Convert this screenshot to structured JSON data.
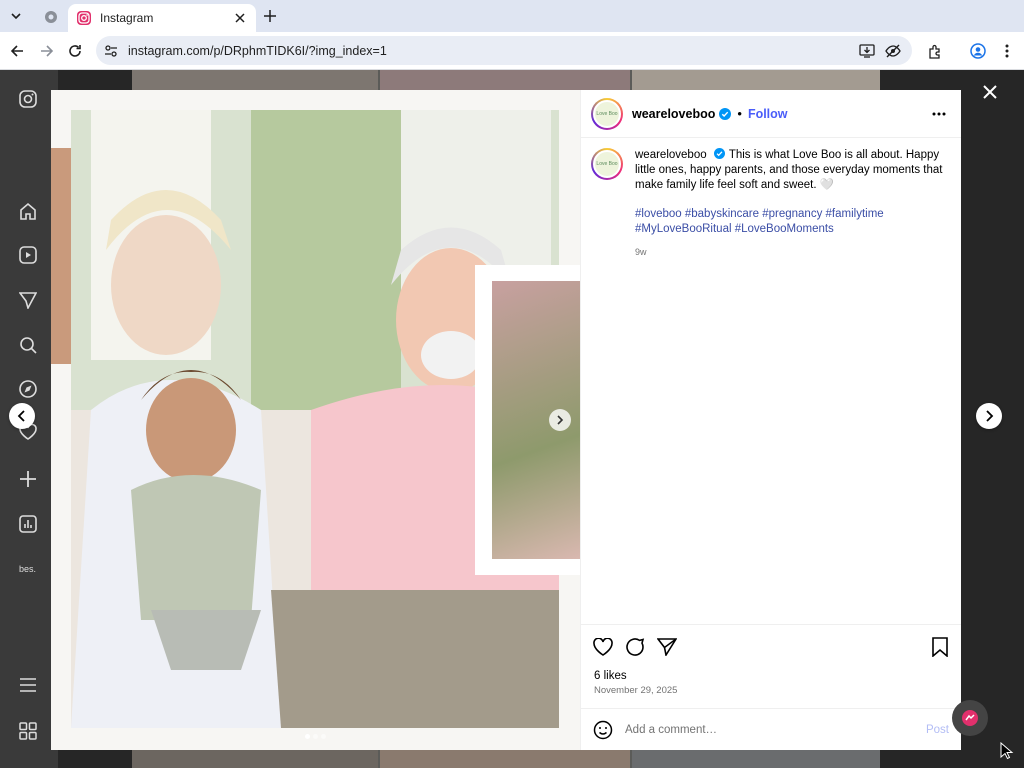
{
  "browser": {
    "tab_title": "Instagram",
    "url": "instagram.com/p/DRphmTIDK6I/?img_index=1"
  },
  "icons": {
    "tab_dropdown": "chevron-down-icon",
    "inactive_tab": "globe-icon",
    "tab_favicon": "instagram-icon",
    "tab_close": "close-icon",
    "new_tab": "plus-icon",
    "back": "arrow-left-icon",
    "forward": "arrow-right-icon",
    "reload": "reload-icon",
    "site_info": "tune-icon",
    "install": "install-app-icon",
    "eye_off": "eye-off-icon",
    "extensions": "puzzle-icon",
    "profile": "profile-icon",
    "menu": "kebab-icon"
  },
  "sidebar": {
    "more_text": "bes."
  },
  "post": {
    "username": "wearelovebo o",
    "handle": "weareloveboo",
    "follow_label": "Follow",
    "separator": "•",
    "avatar_text": "Love Boo",
    "caption_text": "This is what Love Boo is all about. Happy little ones, happy parents, and those everyday moments that make family life feel soft and sweet. 🤍",
    "hashtags": "#loveboo #babyskincare #pregnancy #familytime #MyLoveBooRitual #LoveBooMoments",
    "time_ago": "9w",
    "likes": "6 likes",
    "date": "November 29, 2025",
    "comment_placeholder": "Add a comment…",
    "post_label": "Post",
    "carousel_count": 3,
    "carousel_active_index": 0
  },
  "colors": {
    "accent_follow": "#4a5df9",
    "hashtag": "#3b4ea6",
    "post_disabled": "#b3bdf5"
  }
}
